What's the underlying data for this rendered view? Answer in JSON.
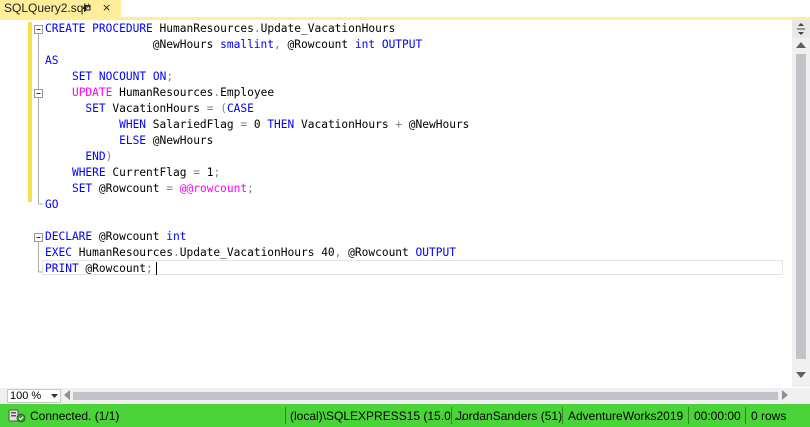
{
  "tab": {
    "title": "SQLQuery2.sql*",
    "close": "×"
  },
  "editor": {
    "lines": [
      [
        {
          "t": "CREATE",
          "c": "kw"
        },
        {
          "t": " "
        },
        {
          "t": "PROCEDURE",
          "c": "kw"
        },
        {
          "t": " HumanResources"
        },
        {
          "t": ".",
          "c": "gr"
        },
        {
          "t": "Update_VacationHours"
        }
      ],
      [
        {
          "t": "                @NewHours "
        },
        {
          "t": "smallint",
          "c": "kw"
        },
        {
          "t": ",",
          "c": "gr"
        },
        {
          "t": " @Rowcount "
        },
        {
          "t": "int",
          "c": "kw"
        },
        {
          "t": " "
        },
        {
          "t": "OUTPUT",
          "c": "kw"
        }
      ],
      [
        {
          "t": "AS",
          "c": "kw"
        }
      ],
      [
        {
          "t": "    "
        },
        {
          "t": "SET",
          "c": "kw"
        },
        {
          "t": " "
        },
        {
          "t": "NOCOUNT",
          "c": "kw"
        },
        {
          "t": " "
        },
        {
          "t": "ON",
          "c": "kw"
        },
        {
          "t": ";",
          "c": "gr"
        }
      ],
      [
        {
          "t": "    "
        },
        {
          "t": "UPDATE",
          "c": "pk"
        },
        {
          "t": " HumanResources"
        },
        {
          "t": ".",
          "c": "gr"
        },
        {
          "t": "Employee"
        }
      ],
      [
        {
          "t": "      "
        },
        {
          "t": "SET",
          "c": "kw"
        },
        {
          "t": " VacationHours "
        },
        {
          "t": "=",
          "c": "gr"
        },
        {
          "t": " "
        },
        {
          "t": "(",
          "c": "gr"
        },
        {
          "t": "CASE",
          "c": "kw"
        }
      ],
      [
        {
          "t": "           "
        },
        {
          "t": "WHEN",
          "c": "kw"
        },
        {
          "t": " SalariedFlag "
        },
        {
          "t": "=",
          "c": "gr"
        },
        {
          "t": " 0 "
        },
        {
          "t": "THEN",
          "c": "kw"
        },
        {
          "t": " VacationHours "
        },
        {
          "t": "+",
          "c": "gr"
        },
        {
          "t": " @NewHours"
        }
      ],
      [
        {
          "t": "           "
        },
        {
          "t": "ELSE",
          "c": "kw"
        },
        {
          "t": " @NewHours"
        }
      ],
      [
        {
          "t": "      "
        },
        {
          "t": "END",
          "c": "kw"
        },
        {
          "t": ")",
          "c": "gr"
        }
      ],
      [
        {
          "t": "    "
        },
        {
          "t": "WHERE",
          "c": "kw"
        },
        {
          "t": " CurrentFlag "
        },
        {
          "t": "=",
          "c": "gr"
        },
        {
          "t": " 1"
        },
        {
          "t": ";",
          "c": "gr"
        }
      ],
      [
        {
          "t": "    "
        },
        {
          "t": "SET",
          "c": "kw"
        },
        {
          "t": " @Rowcount "
        },
        {
          "t": "=",
          "c": "gr"
        },
        {
          "t": " "
        },
        {
          "t": "@@rowcount",
          "c": "pk"
        },
        {
          "t": ";",
          "c": "gr"
        }
      ],
      [
        {
          "t": "GO",
          "c": "kw"
        }
      ],
      [
        {
          "t": ""
        }
      ],
      [
        {
          "t": "DECLARE",
          "c": "kw"
        },
        {
          "t": " @Rowcount "
        },
        {
          "t": "int",
          "c": "kw"
        }
      ],
      [
        {
          "t": "EXEC",
          "c": "kw"
        },
        {
          "t": " HumanResources"
        },
        {
          "t": ".",
          "c": "gr"
        },
        {
          "t": "Update_VacationHours 40"
        },
        {
          "t": ",",
          "c": "gr"
        },
        {
          "t": " @Rowcount "
        },
        {
          "t": "OUTPUT",
          "c": "kw"
        }
      ],
      [
        {
          "t": "PRINT",
          "c": "kw"
        },
        {
          "t": " @Rowcount"
        },
        {
          "t": ";",
          "c": "gr"
        }
      ]
    ]
  },
  "zoom": {
    "value": "100 %"
  },
  "status": {
    "connection": "Connected. (1/1)",
    "server": "(local)\\SQLEXPRESS15 (15.0 ...",
    "user": "JordanSanders (51)",
    "database": "AdventureWorks2019",
    "elapsed": "00:00:00",
    "rows": "0 rows"
  },
  "colors": {
    "keyword": "#0000ff",
    "operator": "#808080",
    "system": "#ff00ff",
    "tab": "#ffee99",
    "status_bar": "#4bd43a"
  },
  "icons": [
    "pin-icon",
    "close-icon",
    "split-icon",
    "scroll-up-icon",
    "scroll-down-icon",
    "scroll-left-icon",
    "scroll-right-icon",
    "dropdown-arrow-icon",
    "connected-icon"
  ]
}
